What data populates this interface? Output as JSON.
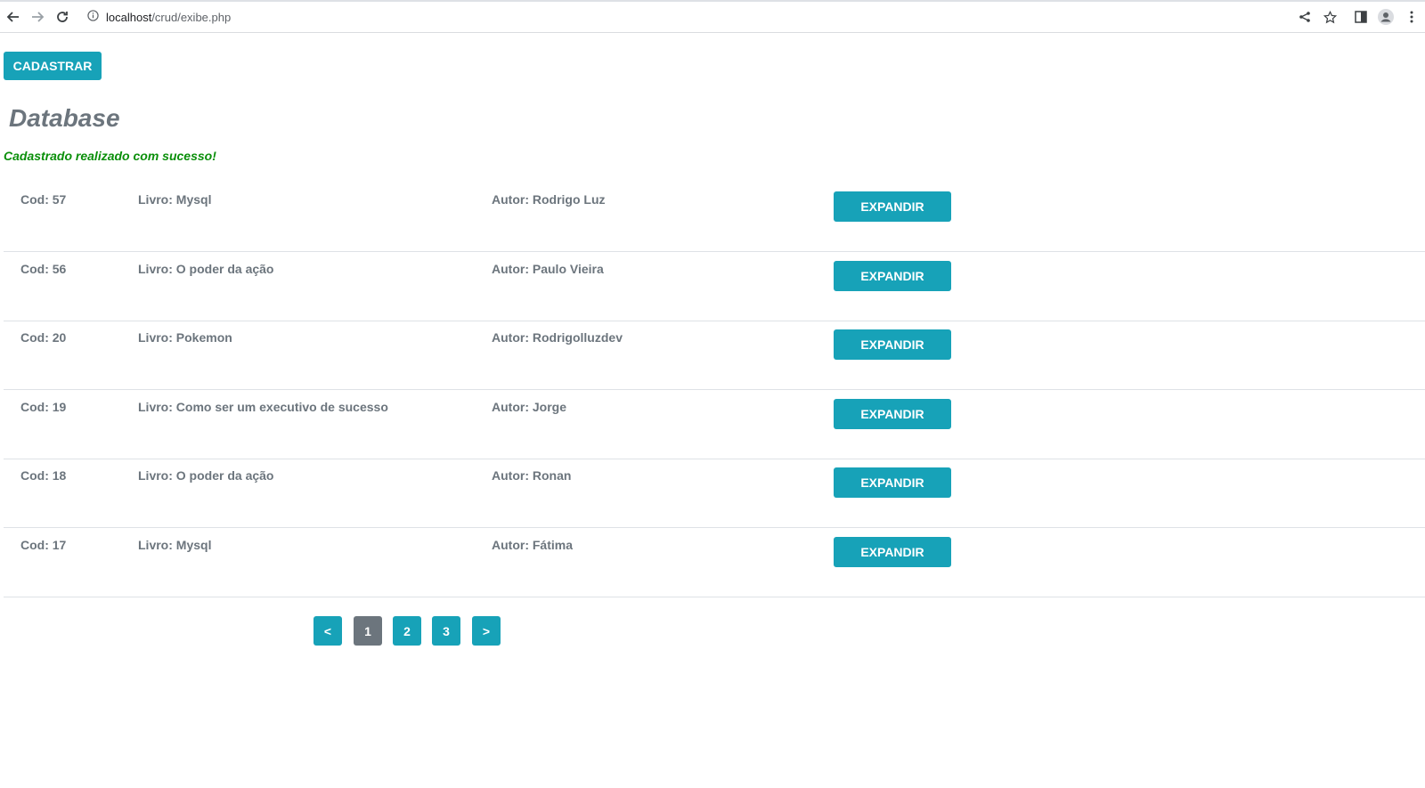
{
  "browser": {
    "url_host": "localhost",
    "url_path": "/crud/exibe.php"
  },
  "toolbar": {
    "cadastrar_label": "CADASTRAR"
  },
  "page": {
    "title": "Database",
    "success_message": "Cadastrado realizado com sucesso!"
  },
  "records": [
    {
      "cod": "Cod: 57",
      "livro": "Livro: Mysql",
      "autor": "Autor: Rodrigo Luz",
      "action": "EXPANDIR"
    },
    {
      "cod": "Cod: 56",
      "livro": "Livro: O poder da ação",
      "autor": "Autor: Paulo Vieira",
      "action": "EXPANDIR"
    },
    {
      "cod": "Cod: 20",
      "livro": "Livro: Pokemon",
      "autor": "Autor: Rodrigolluzdev",
      "action": "EXPANDIR"
    },
    {
      "cod": "Cod: 19",
      "livro": "Livro: Como ser um executivo de sucesso",
      "autor": "Autor: Jorge",
      "action": "EXPANDIR"
    },
    {
      "cod": "Cod: 18",
      "livro": "Livro: O poder da ação",
      "autor": "Autor: Ronan",
      "action": "EXPANDIR"
    },
    {
      "cod": "Cod: 17",
      "livro": "Livro: Mysql",
      "autor": "Autor: Fátima",
      "action": "EXPANDIR"
    }
  ],
  "pagination": {
    "prev": "<",
    "pages": [
      "1",
      "2",
      "3"
    ],
    "next": ">",
    "current": "1"
  },
  "icons": {
    "back": "arrow-left-icon",
    "forward": "arrow-right-icon",
    "reload": "reload-icon",
    "info": "info-icon",
    "share": "share-icon",
    "bookmark": "star-icon",
    "sidepanel": "side-panel-icon",
    "profile": "profile-icon",
    "menu": "kebab-menu-icon"
  },
  "colors": {
    "accent": "#17a2b8",
    "muted": "#6c757d",
    "success": "#0a8f0a"
  }
}
